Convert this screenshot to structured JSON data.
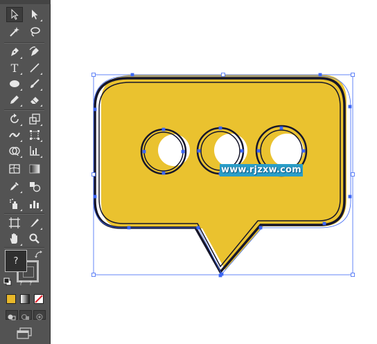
{
  "toolbar": {
    "tools": [
      {
        "name": "selection-tool",
        "icon": "black-arrow-icon"
      },
      {
        "name": "direct-selection-tool",
        "icon": "white-arrow-icon"
      },
      {
        "name": "magic-wand-tool",
        "icon": "magic-wand-icon"
      },
      {
        "name": "lasso-tool",
        "icon": "lasso-icon"
      },
      {
        "name": "pen-tool",
        "icon": "pen-icon"
      },
      {
        "name": "curvature-tool",
        "icon": "curvature-pen-icon"
      },
      {
        "name": "type-tool",
        "icon": "type-icon",
        "glyph": "T"
      },
      {
        "name": "line-segment-tool",
        "icon": "line-icon"
      },
      {
        "name": "ellipse-tool",
        "icon": "ellipse-icon"
      },
      {
        "name": "paintbrush-tool",
        "icon": "paintbrush-icon"
      },
      {
        "name": "pencil-tool",
        "icon": "pencil-icon"
      },
      {
        "name": "eraser-tool",
        "icon": "eraser-icon"
      },
      {
        "name": "rotate-tool",
        "icon": "rotate-icon"
      },
      {
        "name": "scale-tool",
        "icon": "scale-icon"
      },
      {
        "name": "width-tool",
        "icon": "width-icon"
      },
      {
        "name": "free-transform-tool",
        "icon": "free-transform-icon"
      },
      {
        "name": "shape-builder-tool",
        "icon": "shape-builder-icon"
      },
      {
        "name": "graph-tool",
        "icon": "column-graph-icon"
      },
      {
        "name": "mesh-tool",
        "icon": "mesh-icon"
      },
      {
        "name": "gradient-tool",
        "icon": "gradient-icon"
      },
      {
        "name": "eyedropper-tool",
        "icon": "eyedropper-icon"
      },
      {
        "name": "blend-tool",
        "icon": "blend-icon"
      },
      {
        "name": "symbol-sprayer-tool",
        "icon": "symbol-sprayer-icon"
      },
      {
        "name": "column-graph-tool",
        "icon": "bar-graph-icon"
      },
      {
        "name": "artboard-tool",
        "icon": "artboard-icon"
      },
      {
        "name": "slice-tool",
        "icon": "slice-knife-icon"
      },
      {
        "name": "hand-tool",
        "icon": "hand-icon"
      },
      {
        "name": "zoom-tool",
        "icon": "magnifier-icon"
      }
    ],
    "fill_label": "?",
    "small_q1": "?",
    "small_q2": "?",
    "colors": {
      "fill_chip": "#e8b82a",
      "gradient_chip_start": "#ffffff",
      "gradient_chip_end": "#222222",
      "none_chip": "#ffffff",
      "none_slash": "#e0202a"
    }
  },
  "artwork": {
    "bubble_fill": "#eac22f",
    "outline_color": "#16162a",
    "selection_color": "#3c67f5"
  },
  "watermark": {
    "text": "www.rjzxw.com"
  }
}
